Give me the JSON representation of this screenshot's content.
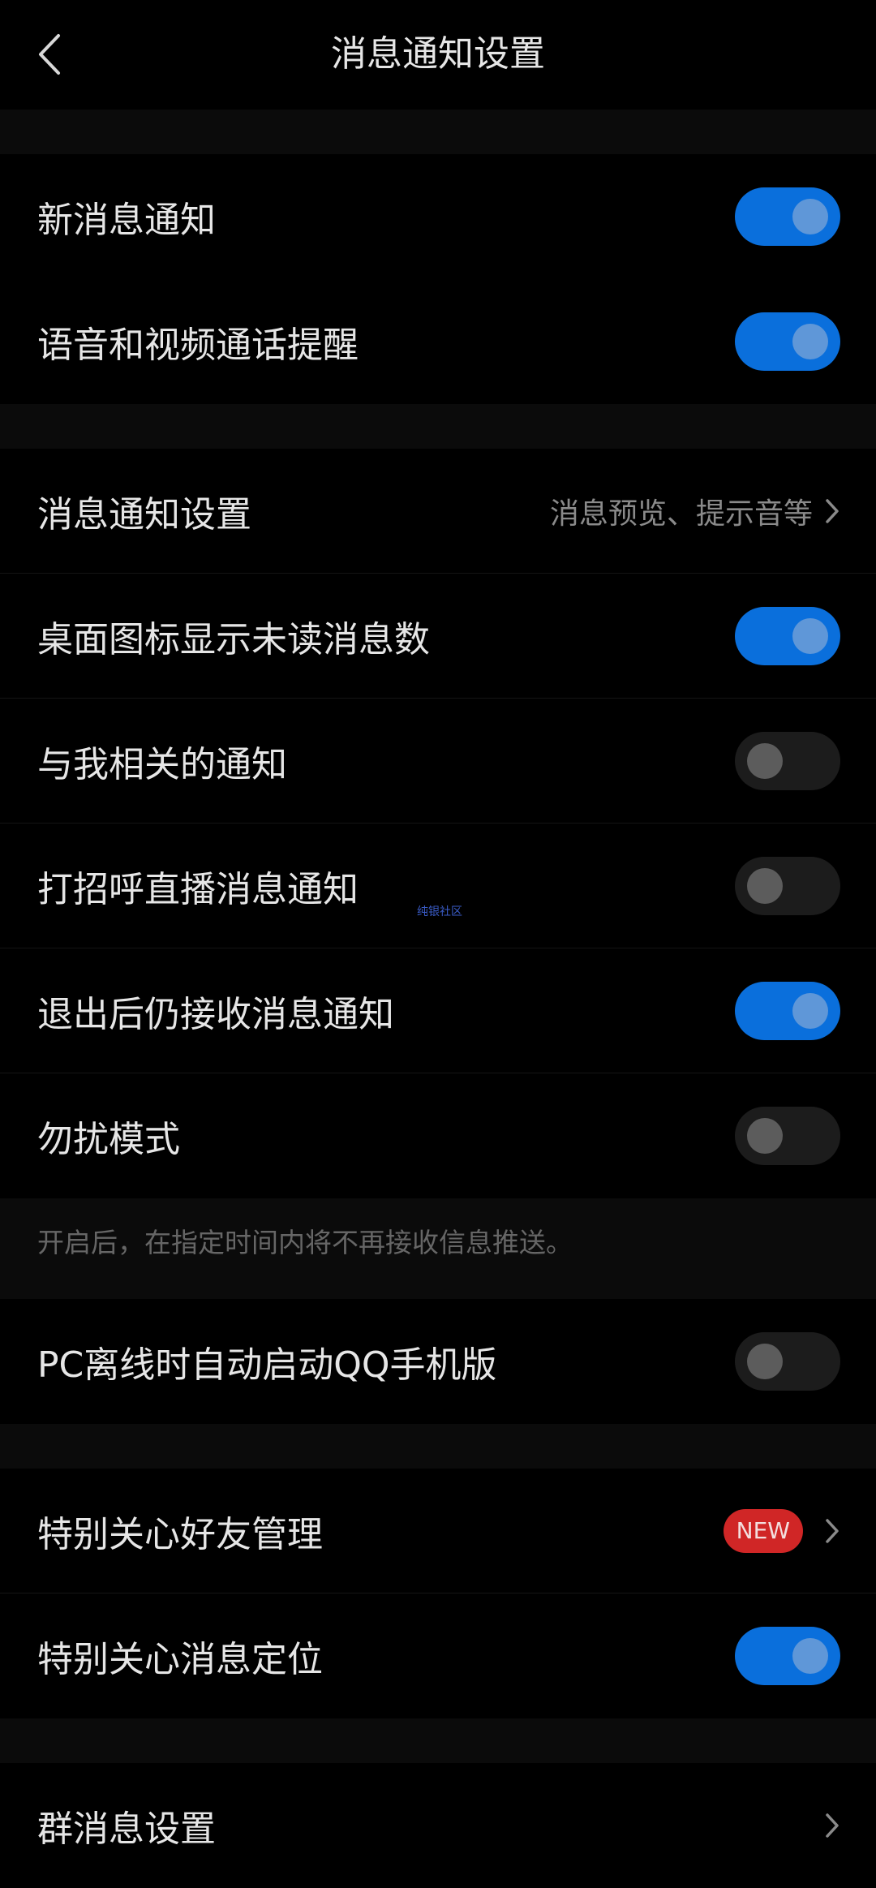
{
  "header": {
    "title": "消息通知设置"
  },
  "group1": [
    {
      "label": "新消息通知",
      "on": true
    },
    {
      "label": "语音和视频通话提醒",
      "on": true
    }
  ],
  "group2": {
    "settings": {
      "label": "消息通知设置",
      "detail": "消息预览、提示音等"
    },
    "toggles": [
      {
        "label": "桌面图标显示未读消息数",
        "on": true
      },
      {
        "label": "与我相关的通知",
        "on": false
      },
      {
        "label": "打招呼直播消息通知",
        "on": false
      },
      {
        "label": "退出后仍接收消息通知",
        "on": true
      },
      {
        "label": "勿扰模式",
        "on": false
      }
    ],
    "note": "开启后，在指定时间内将不再接收信息推送。"
  },
  "group3": [
    {
      "label": "PC离线时自动启动QQ手机版",
      "on": false
    }
  ],
  "group4": {
    "special_manage": {
      "label": "特别关心好友管理",
      "badge": "NEW"
    },
    "special_locate": {
      "label": "特别关心消息定位",
      "on": true
    }
  },
  "group5": {
    "label": "群消息设置"
  },
  "watermark": "纯银社区",
  "colors": {
    "toggle_on": "#0a6fdc",
    "toggle_off": "#1c1c1c",
    "badge": "#d02626"
  }
}
